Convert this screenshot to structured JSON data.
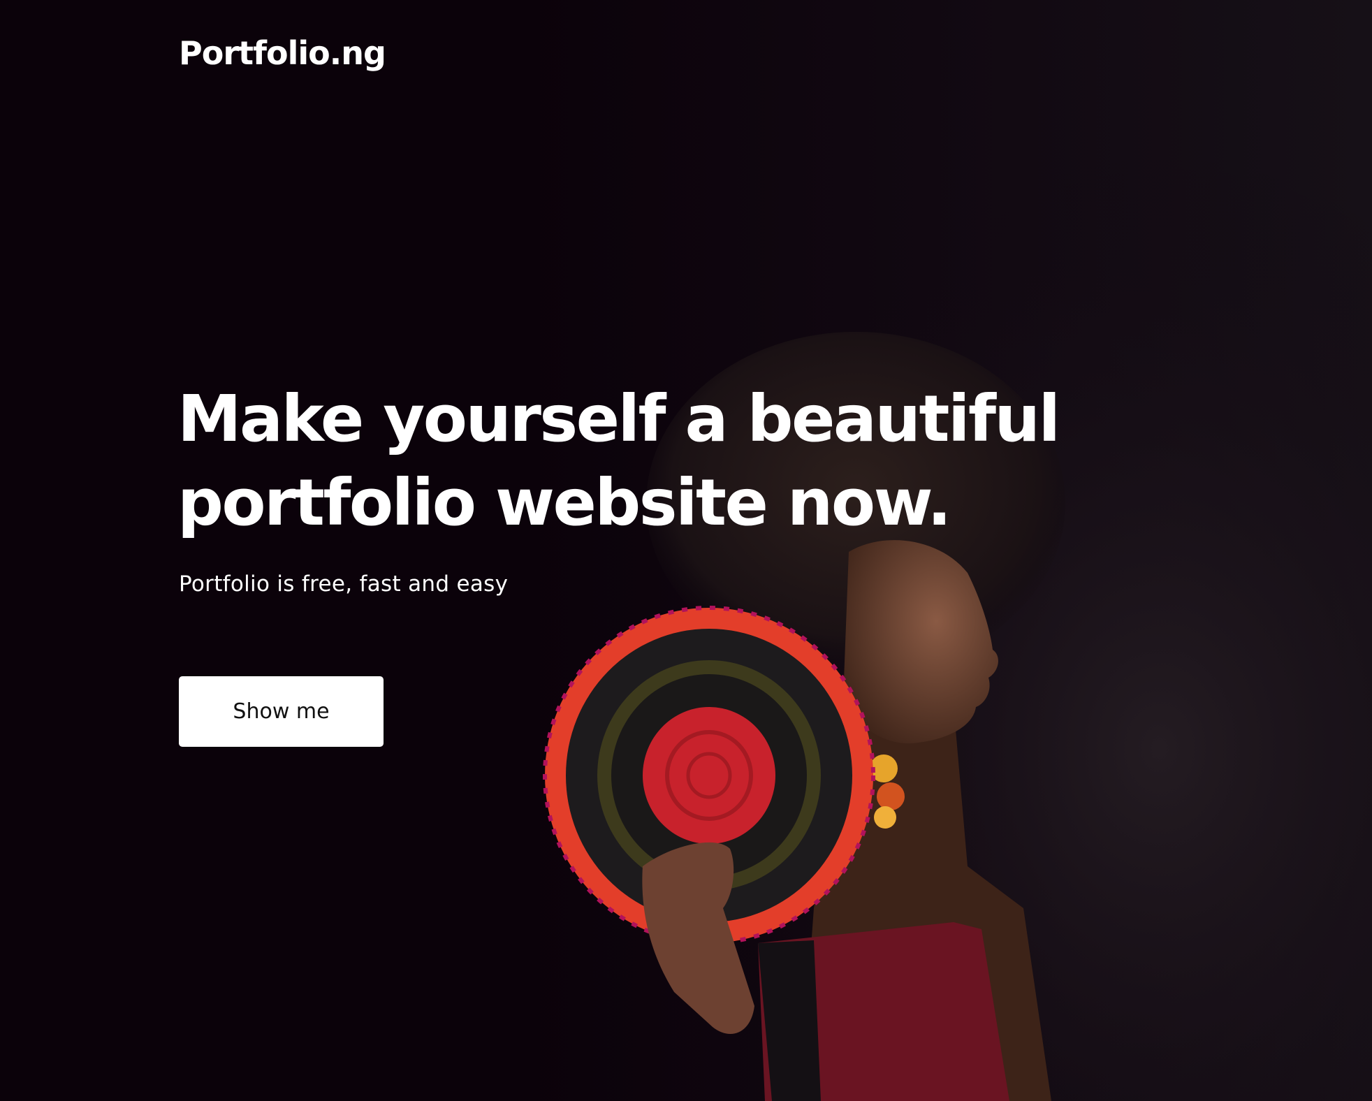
{
  "header": {
    "logo_text": "Portfolio.ng"
  },
  "hero": {
    "headline_line1": "Make yourself a beautiful",
    "headline_line2": "portfolio website now.",
    "subtitle": "Portfolio is free, fast and easy",
    "cta_label": "Show me"
  },
  "colors": {
    "background": "#0b020a",
    "text": "#ffffff",
    "button_bg": "#ffffff",
    "button_text": "#111111"
  }
}
